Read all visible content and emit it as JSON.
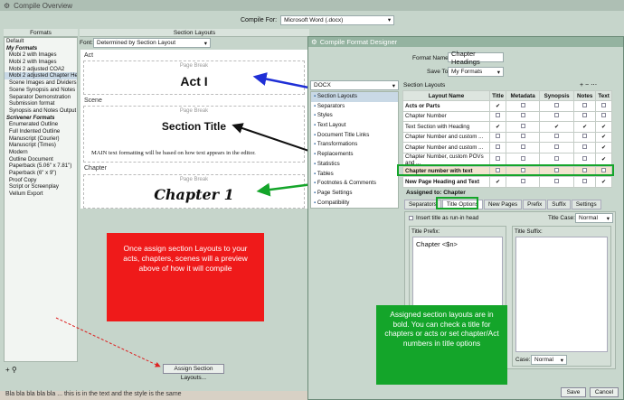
{
  "window": {
    "title": "Compile Overview",
    "compile_for_label": "Compile For:",
    "compile_for_value": "Microsoft Word (.docx)"
  },
  "left": {
    "header": "Formats",
    "items": [
      {
        "t": "Default",
        "c": ""
      },
      {
        "t": "My Formats",
        "c": "cat"
      },
      {
        "t": "Mobi 2 with Images",
        "c": "it"
      },
      {
        "t": "Mobi 2  with Images",
        "c": "it"
      },
      {
        "t": "Mobi 2 adjusted COA2",
        "c": "it"
      },
      {
        "t": "Mobi 2 adjusted Chapter Heads",
        "c": "it sel2"
      },
      {
        "t": "Scene Images and Dividers",
        "c": "it"
      },
      {
        "t": "Scene Synopsis and Notes output",
        "c": "it"
      },
      {
        "t": "Separator Demonstration",
        "c": "it"
      },
      {
        "t": "Submission format",
        "c": "it"
      },
      {
        "t": "Synopsis and Notes Output",
        "c": "it"
      },
      {
        "t": "Scrivener Formats",
        "c": "cat"
      },
      {
        "t": "Enumerated Outline",
        "c": "it"
      },
      {
        "t": "Full Indented Outline",
        "c": "it"
      },
      {
        "t": "Manuscript (Courier)",
        "c": "it"
      },
      {
        "t": "Manuscript (Times)",
        "c": "it"
      },
      {
        "t": "Modern",
        "c": "it"
      },
      {
        "t": "Outline Document",
        "c": "it"
      },
      {
        "t": "Paperback (5.06\" x 7.81\")",
        "c": "it"
      },
      {
        "t": "Paperback (6\" x 9\")",
        "c": "it"
      },
      {
        "t": "Proof Copy",
        "c": "it"
      },
      {
        "t": "Script or Screenplay",
        "c": "it"
      },
      {
        "t": "Vellum Export",
        "c": "it"
      }
    ]
  },
  "section_layouts": {
    "header": "Section Layouts",
    "font_label": "Font:",
    "font_value": "Determined by Section Layout",
    "act_label": "Act",
    "scene_label": "Scene",
    "chapter_label": "Chapter",
    "page_break": "Page Break",
    "act_title": "Act I",
    "section_title": "Section Title",
    "body_text": "MAIN text formatting will be based on how text appears in the editor.",
    "chapter_title": "Chapter 1",
    "assign_button": "Assign Section Layouts..."
  },
  "red_note": "Once assign section Layouts to your acts, chapters, scenes will a preview above of how it will compile",
  "dialog": {
    "title": "Compile Format Designer",
    "format_name_label": "Format Name:",
    "format_name_value": "Chapter Headings",
    "save_to_label": "Save To:",
    "save_to_value": "My Formats",
    "docx": "DOCX",
    "side_items": [
      "Section Layouts",
      "Separators",
      "Styles",
      "Text Layout",
      "Document Title Links",
      "Transformations",
      "Replacements",
      "Statistics",
      "Tables",
      "Footnotes & Comments",
      "Page Settings",
      "Compatibility"
    ],
    "layouts_header": "Section Layouts",
    "cols": [
      "Layout Name",
      "Title",
      "Metadata",
      "Synopsis",
      "Notes",
      "Text"
    ],
    "rows": [
      {
        "n": "Acts or Parts",
        "b": true,
        "v": [
          1,
          0,
          0,
          0,
          0
        ]
      },
      {
        "n": "Chapter Number",
        "b": false,
        "v": [
          0,
          0,
          0,
          0,
          0
        ]
      },
      {
        "n": "Text Section with Heading",
        "b": false,
        "v": [
          1,
          0,
          1,
          1,
          1
        ]
      },
      {
        "n": "Chapter Number and custom ...",
        "b": false,
        "v": [
          0,
          0,
          0,
          0,
          1
        ]
      },
      {
        "n": "Chapter Number and custom ...",
        "b": false,
        "v": [
          0,
          0,
          0,
          0,
          1
        ]
      },
      {
        "n": "Chapter Number, custom POVs and ...",
        "b": false,
        "v": [
          0,
          0,
          0,
          0,
          1
        ]
      },
      {
        "n": "Chapter number with text",
        "b": true,
        "v": [
          0,
          0,
          0,
          0,
          0
        ]
      },
      {
        "n": "New Page Heading and Text",
        "b": true,
        "v": [
          1,
          0,
          0,
          0,
          1
        ]
      }
    ],
    "assigned_label": "Assigned to:",
    "assigned_value": "Chapter",
    "tabs": [
      "Separators",
      "Title Options",
      "New Pages",
      "Prefix",
      "Suffix",
      "Settings"
    ],
    "insert_runin": "Insert title as run-in head",
    "title_case_label": "Title Case:",
    "title_case_value": "Normal",
    "title_prefix_label": "Title Prefix:",
    "title_prefix_value": "Chapter <$n>",
    "title_suffix_label": "Title Suffix:",
    "case_label": "Case:",
    "case_value": "Normal",
    "save": "Save",
    "cancel": "Cancel"
  },
  "green_note": "Assigned section layouts are in bold. You can check a title for chapters or acts or set chapter/Act numbers in title options",
  "bottom_text": "Bla bla bla bla bla ... this is in the text and the style is the same"
}
